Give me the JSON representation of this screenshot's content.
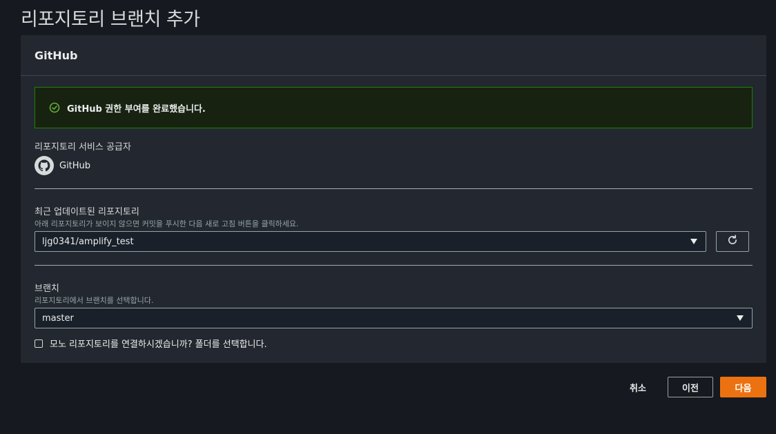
{
  "page": {
    "title": "리포지토리 브랜치 추가"
  },
  "panel": {
    "title": "GitHub"
  },
  "alert": {
    "message": "GitHub 권한 부여를 완료했습니다.",
    "icon": "check-circle-icon",
    "color": "#1d8102"
  },
  "provider": {
    "label": "리포지토리 서비스 공급자",
    "name": "GitHub",
    "icon": "github-icon"
  },
  "repository": {
    "label": "최근 업데이트된 리포지토리",
    "description": "아래 리포지토리가 보이지 않으면 커밋을 푸시한 다음 새로 고침 버튼을 클릭하세요.",
    "selected": "ljg0341/amplify_test",
    "refresh_icon": "refresh-icon"
  },
  "branch": {
    "label": "브랜치",
    "description": "리포지토리에서 브랜치를 선택합니다.",
    "selected": "master"
  },
  "monorepo": {
    "label": "모노 리포지토리를 연결하시겠습니까? 폴더를 선택합니다.",
    "checked": false
  },
  "footer": {
    "cancel_label": "취소",
    "prev_label": "이전",
    "next_label": "다음",
    "accent_color": "#ec7211"
  }
}
